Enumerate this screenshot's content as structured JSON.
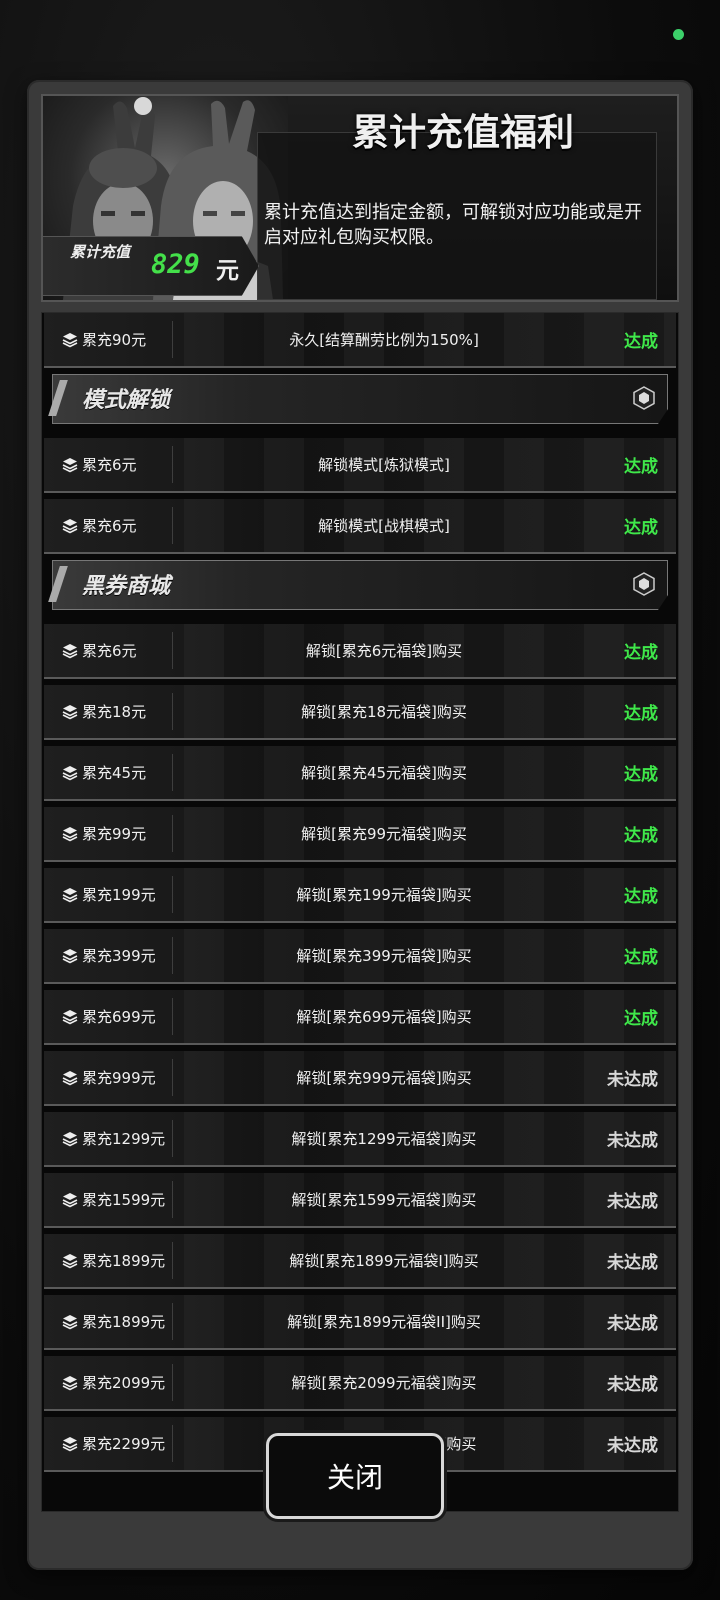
{
  "header": {
    "title": "累计充值福利",
    "description": "累计充值达到指定金额，可解锁对应功能或是开启对应礼包购买权限。",
    "total_label": "累计充值",
    "total_value": "829",
    "total_unit": "元"
  },
  "rows_top": [
    {
      "req": "累充90元",
      "reward": "永久[结算酬劳比例为150%]",
      "status": "达成",
      "done": true
    }
  ],
  "section_mode": {
    "name": "模式解锁",
    "rows": [
      {
        "req": "累充6元",
        "reward": "解锁模式[炼狱模式]",
        "status": "达成",
        "done": true
      },
      {
        "req": "累充6元",
        "reward": "解锁模式[战棋模式]",
        "status": "达成",
        "done": true
      }
    ]
  },
  "section_shop": {
    "name": "黑券商城",
    "rows": [
      {
        "req": "累充6元",
        "reward": "解锁[累充6元福袋]购买",
        "status": "达成",
        "done": true
      },
      {
        "req": "累充18元",
        "reward": "解锁[累充18元福袋]购买",
        "status": "达成",
        "done": true
      },
      {
        "req": "累充45元",
        "reward": "解锁[累充45元福袋]购买",
        "status": "达成",
        "done": true
      },
      {
        "req": "累充99元",
        "reward": "解锁[累充99元福袋]购买",
        "status": "达成",
        "done": true
      },
      {
        "req": "累充199元",
        "reward": "解锁[累充199元福袋]购买",
        "status": "达成",
        "done": true
      },
      {
        "req": "累充399元",
        "reward": "解锁[累充399元福袋]购买",
        "status": "达成",
        "done": true
      },
      {
        "req": "累充699元",
        "reward": "解锁[累充699元福袋]购买",
        "status": "达成",
        "done": true
      },
      {
        "req": "累充999元",
        "reward": "解锁[累充999元福袋]购买",
        "status": "未达成",
        "done": false
      },
      {
        "req": "累充1299元",
        "reward": "解锁[累充1299元福袋]购买",
        "status": "未达成",
        "done": false
      },
      {
        "req": "累充1599元",
        "reward": "解锁[累充1599元福袋]购买",
        "status": "未达成",
        "done": false
      },
      {
        "req": "累充1899元",
        "reward": "解锁[累充1899元福袋I]购买",
        "status": "未达成",
        "done": false
      },
      {
        "req": "累充1899元",
        "reward": "解锁[累充1899元福袋II]购买",
        "status": "未达成",
        "done": false
      },
      {
        "req": "累充2099元",
        "reward": "解锁[累充2099元福袋]购买",
        "status": "未达成",
        "done": false
      },
      {
        "req": "累充2299元",
        "reward": "解锁[累充2299元福袋]购买",
        "status": "未达成",
        "done": false
      }
    ]
  },
  "close_button": {
    "label": "关闭"
  },
  "colors": {
    "done": "#3fe84a",
    "pending": "#d8d8d8",
    "total": "#44e04a",
    "status_dot": "#3cd06a"
  }
}
